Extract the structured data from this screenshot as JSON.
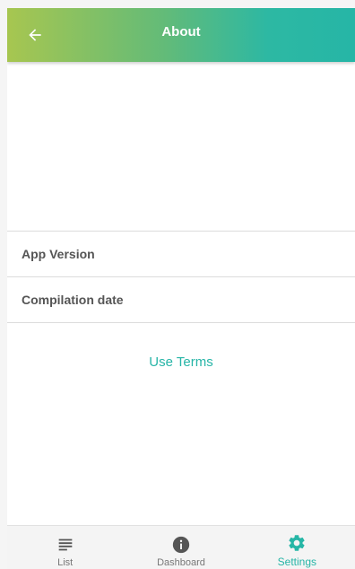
{
  "header": {
    "title": "About",
    "back_icon": "arrow-back-icon"
  },
  "rows": [
    {
      "label": "App Version"
    },
    {
      "label": "Compilation date"
    }
  ],
  "links": {
    "use_terms": "Use Terms"
  },
  "nav": {
    "items": [
      {
        "label": "List",
        "icon": "list-icon",
        "active": false
      },
      {
        "label": "Dashboard",
        "icon": "info-icon",
        "active": false
      },
      {
        "label": "Settings",
        "icon": "gear-icon",
        "active": true
      }
    ]
  },
  "colors": {
    "accent": "#26b6a6",
    "header_gradient_start": "#a7c650",
    "header_gradient_end": "#26b6a6",
    "inactive_icon": "#555555"
  }
}
